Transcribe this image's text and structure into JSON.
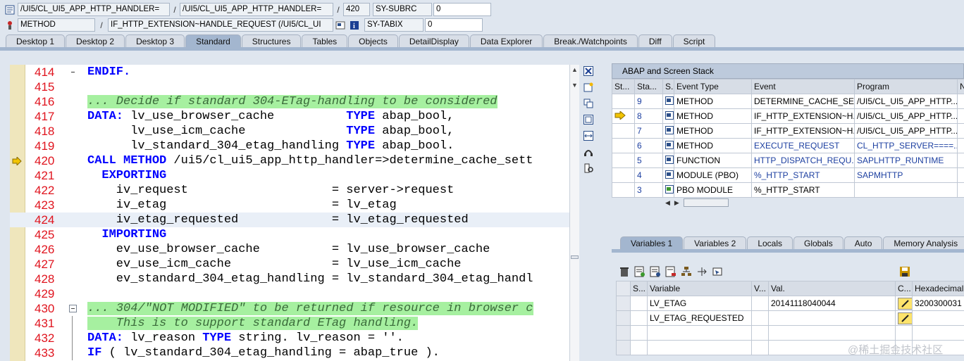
{
  "header": {
    "row1": {
      "program1": "/UI5/CL_UI5_APP_HTTP_HANDLER=",
      "sep1": "/",
      "program2": "/UI5/CL_UI5_APP_HTTP_HANDLER=",
      "sep2": "/",
      "line_no": "420",
      "sysvar1_name": "SY-SUBRC",
      "sysvar1_value": "0"
    },
    "row2": {
      "event_type": "METHOD",
      "sep": "/",
      "event": "IF_HTTP_EXTENSION~HANDLE_REQUEST (/UI5/CL_UI",
      "sysvar2_name": "SY-TABIX",
      "sysvar2_value": "0"
    }
  },
  "tabs": [
    {
      "label": "Desktop 1"
    },
    {
      "label": "Desktop 2"
    },
    {
      "label": "Desktop 3"
    },
    {
      "label": "Standard"
    },
    {
      "label": "Structures"
    },
    {
      "label": "Tables"
    },
    {
      "label": "Objects"
    },
    {
      "label": "DetailDisplay"
    },
    {
      "label": "Data Explorer"
    },
    {
      "label": "Break./Watchpoints"
    },
    {
      "label": "Diff"
    },
    {
      "label": "Script"
    }
  ],
  "active_tab": "Standard",
  "editor": {
    "lines": [
      {
        "n": "414",
        "parts": [
          {
            "t": "ENDIF.",
            "c": "kw"
          }
        ]
      },
      {
        "n": "415",
        "parts": []
      },
      {
        "n": "416",
        "parts": [
          {
            "t": "... Decide if standard 304-ETag-handling to be considered",
            "c": "cm"
          }
        ]
      },
      {
        "n": "417",
        "parts": [
          {
            "t": "DATA:",
            "c": "kw"
          },
          {
            "t": " lv_use_browser_cache          ",
            "c": ""
          },
          {
            "t": "TYPE",
            "c": "kw"
          },
          {
            "t": " abap_bool,",
            "c": ""
          }
        ]
      },
      {
        "n": "418",
        "parts": [
          {
            "t": "      lv_use_icm_cache              ",
            "c": ""
          },
          {
            "t": "TYPE",
            "c": "kw"
          },
          {
            "t": " abap_bool,",
            "c": ""
          }
        ]
      },
      {
        "n": "419",
        "parts": [
          {
            "t": "      lv_standard_304_etag_handling ",
            "c": ""
          },
          {
            "t": "TYPE",
            "c": "kw"
          },
          {
            "t": " abap_bool.",
            "c": ""
          }
        ]
      },
      {
        "n": "420",
        "parts": [
          {
            "t": "CALL METHOD",
            "c": "kw"
          },
          {
            "t": " /ui5/cl_ui5_app_http_handler=>determine_cache_sett",
            "c": ""
          }
        ]
      },
      {
        "n": "421",
        "parts": [
          {
            "t": "  EXPORTING",
            "c": "kw"
          }
        ]
      },
      {
        "n": "422",
        "parts": [
          {
            "t": "    iv_request                    = server->request",
            "c": ""
          }
        ]
      },
      {
        "n": "423",
        "parts": [
          {
            "t": "    iv_etag                       = lv_etag",
            "c": ""
          }
        ]
      },
      {
        "n": "424",
        "parts": [
          {
            "t": "    iv_etag_requested             = lv_etag_requested",
            "c": ""
          }
        ]
      },
      {
        "n": "425",
        "parts": [
          {
            "t": "  IMPORTING",
            "c": "kw"
          }
        ]
      },
      {
        "n": "426",
        "parts": [
          {
            "t": "    ev_use_browser_cache          = lv_use_browser_cache",
            "c": ""
          }
        ]
      },
      {
        "n": "427",
        "parts": [
          {
            "t": "    ev_use_icm_cache              = lv_use_icm_cache",
            "c": ""
          }
        ]
      },
      {
        "n": "428",
        "parts": [
          {
            "t": "    ev_standard_304_etag_handling = lv_standard_304_etag_handl",
            "c": ""
          }
        ]
      },
      {
        "n": "429",
        "parts": []
      },
      {
        "n": "430",
        "parts": [
          {
            "t": "... 304/\"NOT MODIFIED\" to be returned if resource in browser c",
            "c": "cm"
          }
        ]
      },
      {
        "n": "431",
        "parts": [
          {
            "t": "    This is to support standard ETag handling.",
            "c": "cm"
          }
        ]
      },
      {
        "n": "432",
        "parts": [
          {
            "t": "DATA:",
            "c": "kw"
          },
          {
            "t": " lv_reason ",
            "c": ""
          },
          {
            "t": "TYPE",
            "c": "kw"
          },
          {
            "t": " string. lv_reason = ''.",
            "c": ""
          }
        ]
      },
      {
        "n": "433",
        "parts": [
          {
            "t": "IF",
            "c": "kw"
          },
          {
            "t": " ( lv_standard_304_etag_handling = abap_true ).",
            "c": ""
          }
        ]
      }
    ]
  },
  "stack": {
    "title": "ABAP and Screen Stack",
    "columns": [
      "St...",
      "Sta...",
      "S...",
      "Event Type",
      "Event",
      "Program",
      "N"
    ],
    "rows": [
      {
        "level": "9",
        "type": "METHOD",
        "event": "DETERMINE_CACHE_SET...",
        "program": "/UI5/CL_UI5_APP_HTTP...",
        "current": false
      },
      {
        "level": "8",
        "type": "METHOD",
        "event": "IF_HTTP_EXTENSION~H...",
        "program": "/UI5/CL_UI5_APP_HTTP...",
        "current": true
      },
      {
        "level": "7",
        "type": "METHOD",
        "event": "IF_HTTP_EXTENSION~H...",
        "program": "/UI5/CL_UI5_APP_HTTP...",
        "current": false
      },
      {
        "level": "6",
        "type": "METHOD",
        "event": "EXECUTE_REQUEST",
        "program": "CL_HTTP_SERVER====...",
        "current": false
      },
      {
        "level": "5",
        "type": "FUNCTION",
        "event": "HTTP_DISPATCH_REQU...",
        "program": "SAPLHTTP_RUNTIME",
        "current": false
      },
      {
        "level": "4",
        "type": "MODULE (PBO)",
        "event": "%_HTTP_START",
        "program": "SAPMHTTP",
        "current": false
      },
      {
        "level": "3",
        "type": "PBO MODULE",
        "event": "%_HTTP_START",
        "program": "",
        "current": false
      }
    ]
  },
  "var_tabs": [
    {
      "label": "Variables 1"
    },
    {
      "label": "Variables 2"
    },
    {
      "label": "Locals"
    },
    {
      "label": "Globals"
    },
    {
      "label": "Auto"
    },
    {
      "label": "Memory Analysis"
    }
  ],
  "active_var_tab": "Variables 1",
  "variables": {
    "columns": [
      "S...",
      "Variable",
      "V...",
      "Val.",
      "C...",
      "Hexadecimal"
    ],
    "rows": [
      {
        "name": "LV_ETAG",
        "value": "20141118040044",
        "hex": "3200300031"
      },
      {
        "name": "LV_ETAG_REQUESTED",
        "value": "",
        "hex": ""
      }
    ]
  },
  "watermark": "@稀土掘金技术社区",
  "colors": {
    "keyword": "#0000ff",
    "comment_bg": "#a6f0a0",
    "line_number": "#e0141e",
    "tab_active": "#a3b6cf"
  }
}
